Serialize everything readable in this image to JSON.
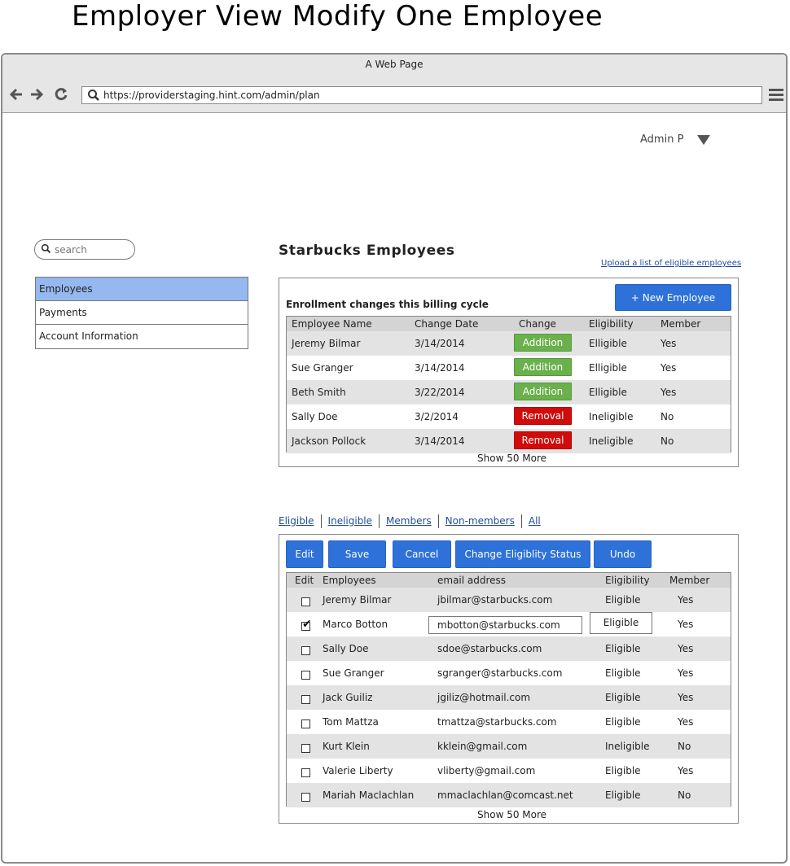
{
  "page_title": "Employer View Modify One Employee",
  "browser": {
    "window_title": "A Web Page",
    "url": "https://providerstaging.hint.com/admin/plan"
  },
  "header": {
    "user": "Admin P"
  },
  "sidebar": {
    "search_placeholder": "search",
    "items": [
      {
        "label": "Employees",
        "active": true
      },
      {
        "label": "Payments",
        "active": false
      },
      {
        "label": "Account Information",
        "active": false
      }
    ]
  },
  "main": {
    "title": "Starbucks Employees",
    "upload_link": "Upload a list of eligible employees",
    "enrollment": {
      "title": "Enrollment changes this billing cycle",
      "new_button": "+ New Employee",
      "columns": [
        "Employee Name",
        "Change Date",
        "Change",
        "Eligibility",
        "Member"
      ],
      "rows": [
        {
          "name": "Jeremy Bilmar",
          "date": "3/14/2014",
          "change": "Addition",
          "eligibility": "Elligible",
          "member": "Yes"
        },
        {
          "name": "Sue Granger",
          "date": "3/14/2014",
          "change": "Addition",
          "eligibility": "Elligible",
          "member": "Yes"
        },
        {
          "name": "Beth Smith",
          "date": "3/22/2014",
          "change": "Addition",
          "eligibility": "Elligible",
          "member": "Yes"
        },
        {
          "name": "Sally Doe",
          "date": "3/2/2014",
          "change": "Removal",
          "eligibility": "Ineligible",
          "member": "No"
        },
        {
          "name": "Jackson Pollock",
          "date": "3/14/2014",
          "change": "Removal",
          "eligibility": "Ineligible",
          "member": "No"
        }
      ],
      "show_more": "Show 50 More"
    },
    "filters": [
      "Eligible",
      "Ineligible",
      "Members",
      "Non-members",
      "All"
    ],
    "employees": {
      "buttons": {
        "edit": "Edit",
        "save": "Save",
        "cancel": "Cancel",
        "change_status": "Change Eligiblity Status",
        "undo": "Undo"
      },
      "columns": [
        "Edit",
        "Employees",
        "email address",
        "Eligibility",
        "Member"
      ],
      "rows": [
        {
          "checked": false,
          "name": "Jeremy Bilmar",
          "email": "jbilmar@starbucks.com",
          "eligibility": "Eligible",
          "member": "Yes"
        },
        {
          "checked": true,
          "name": "Marco Botton",
          "email": "mbotton@starbucks.com",
          "eligibility": "Eligible",
          "member": "Yes",
          "editing": true
        },
        {
          "checked": false,
          "name": "Sally Doe",
          "email": "sdoe@starbucks.com",
          "eligibility": "Eligible",
          "member": "Yes"
        },
        {
          "checked": false,
          "name": "Sue Granger",
          "email": "sgranger@starbucks.com",
          "eligibility": "Eligible",
          "member": "Yes"
        },
        {
          "checked": false,
          "name": "Jack Guiliz",
          "email": "jgiliz@hotmail.com",
          "eligibility": "Eligible",
          "member": "Yes"
        },
        {
          "checked": false,
          "name": "Tom Mattza",
          "email": "tmattza@starbucks.com",
          "eligibility": "Eligible",
          "member": "Yes"
        },
        {
          "checked": false,
          "name": "Kurt Klein",
          "email": "kklein@gmail.com",
          "eligibility": "Ineligible",
          "member": "No"
        },
        {
          "checked": false,
          "name": "Valerie Liberty",
          "email": "vliberty@gmail.com",
          "eligibility": "Eligible",
          "member": "Yes"
        },
        {
          "checked": false,
          "name": "Mariah Maclachlan",
          "email": "mmaclachlan@comcast.net",
          "eligibility": "Eligible",
          "member": "No"
        }
      ],
      "show_more": "Show 50 More"
    }
  },
  "colors": {
    "accent_blue": "#2d71d9",
    "nav_active": "#95b9ef",
    "addition_green": "#6ab04c",
    "removal_red": "#d10a0a",
    "link_blue": "#1f4d9a"
  },
  "icons": [
    "back-arrow-icon",
    "forward-arrow-icon",
    "reload-icon",
    "search-icon",
    "hamburger-menu-icon",
    "caret-down-icon"
  ]
}
